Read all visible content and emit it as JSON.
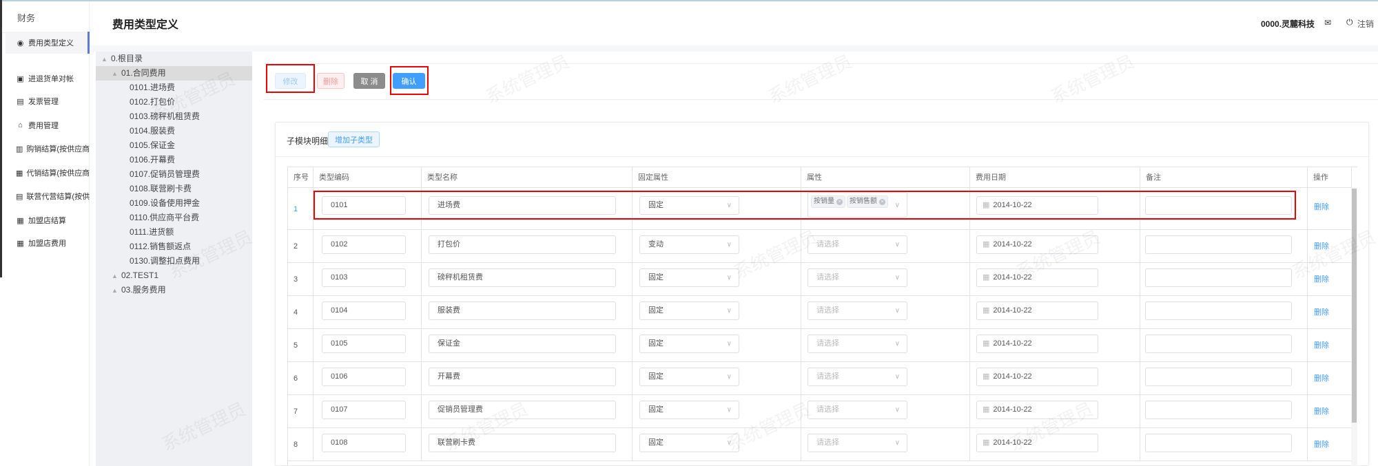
{
  "app": {
    "section": "财务",
    "page_title": "费用类型定义"
  },
  "header": {
    "company": "0000.灵麓科技",
    "logout": "注销"
  },
  "sidebar": {
    "items": [
      {
        "label": "费用类型定义",
        "icon": "radio-icon",
        "active": true
      },
      {
        "label": "进退货单对帐",
        "icon": "reconcile-icon"
      },
      {
        "label": "发票管理",
        "icon": "invoice-icon"
      },
      {
        "label": "费用管理",
        "icon": "house-icon"
      },
      {
        "label": "购销结算(按供应商)",
        "icon": "bar-chart-icon"
      },
      {
        "label": "代销结算(按供应商)",
        "icon": "grid-icon"
      },
      {
        "label": "联营代营结算(按供…",
        "icon": "document-icon"
      },
      {
        "label": "加盟店结算",
        "icon": "grid-icon"
      },
      {
        "label": "加盟店费用",
        "icon": "grid-icon"
      }
    ]
  },
  "tree": {
    "nodes": [
      {
        "label": "0.根目录",
        "level": 0
      },
      {
        "label": "01.合同费用",
        "level": 1,
        "selected": true
      },
      {
        "label": "0101.进场费",
        "level": 2
      },
      {
        "label": "0102.打包价",
        "level": 2
      },
      {
        "label": "0103.磅秤机租赁费",
        "level": 2
      },
      {
        "label": "0104.服装费",
        "level": 2
      },
      {
        "label": "0105.保证金",
        "level": 2
      },
      {
        "label": "0106.开幕费",
        "level": 2
      },
      {
        "label": "0107.促销员管理费",
        "level": 2
      },
      {
        "label": "0108.联营刷卡费",
        "level": 2
      },
      {
        "label": "0109.设备使用押金",
        "level": 2
      },
      {
        "label": "0110.供应商平台费",
        "level": 2
      },
      {
        "label": "0111.进货额",
        "level": 2
      },
      {
        "label": "0112.销售额返点",
        "level": 2
      },
      {
        "label": "0130.调整扣点费用",
        "level": 2
      },
      {
        "label": "02.TEST1",
        "level": 1
      },
      {
        "label": "03.服务费用",
        "level": 1
      }
    ]
  },
  "toolbar": {
    "edit": "修改",
    "delete": "删除",
    "cancel": "取 消",
    "confirm": "确认"
  },
  "detail": {
    "title": "子模块明细",
    "add_button": "增加子类型",
    "columns": [
      "序号",
      "类型编码",
      "类型名称",
      "固定属性",
      "属性",
      "费用日期",
      "备注",
      "操作"
    ],
    "attr_placeholder": "请选择",
    "delete_link": "删除",
    "rows": [
      {
        "no": "1",
        "code": "0101",
        "name": "进场费",
        "fixed": "固定",
        "attrs": [
          "按销量",
          "按销售额"
        ],
        "date": "2014-10-22",
        "remark": ""
      },
      {
        "no": "2",
        "code": "0102",
        "name": "打包价",
        "fixed": "变动",
        "attrs": [],
        "date": "2014-10-22",
        "remark": ""
      },
      {
        "no": "3",
        "code": "0103",
        "name": "磅秤机租赁费",
        "fixed": "固定",
        "attrs": [],
        "date": "2014-10-22",
        "remark": ""
      },
      {
        "no": "4",
        "code": "0104",
        "name": "服装费",
        "fixed": "固定",
        "attrs": [],
        "date": "2014-10-22",
        "remark": ""
      },
      {
        "no": "5",
        "code": "0105",
        "name": "保证金",
        "fixed": "固定",
        "attrs": [],
        "date": "2014-10-22",
        "remark": ""
      },
      {
        "no": "6",
        "code": "0106",
        "name": "开幕费",
        "fixed": "固定",
        "attrs": [],
        "date": "2014-10-22",
        "remark": ""
      },
      {
        "no": "7",
        "code": "0107",
        "name": "促销员管理费",
        "fixed": "固定",
        "attrs": [],
        "date": "2014-10-22",
        "remark": ""
      },
      {
        "no": "8",
        "code": "0108",
        "name": "联营刷卡费",
        "fixed": "固定",
        "attrs": [],
        "date": "2014-10-22",
        "remark": ""
      }
    ]
  },
  "watermark": "系统管理员",
  "colors": {
    "primary": "#409eff",
    "danger": "#f56c6c",
    "highlight": "#ee0000"
  }
}
